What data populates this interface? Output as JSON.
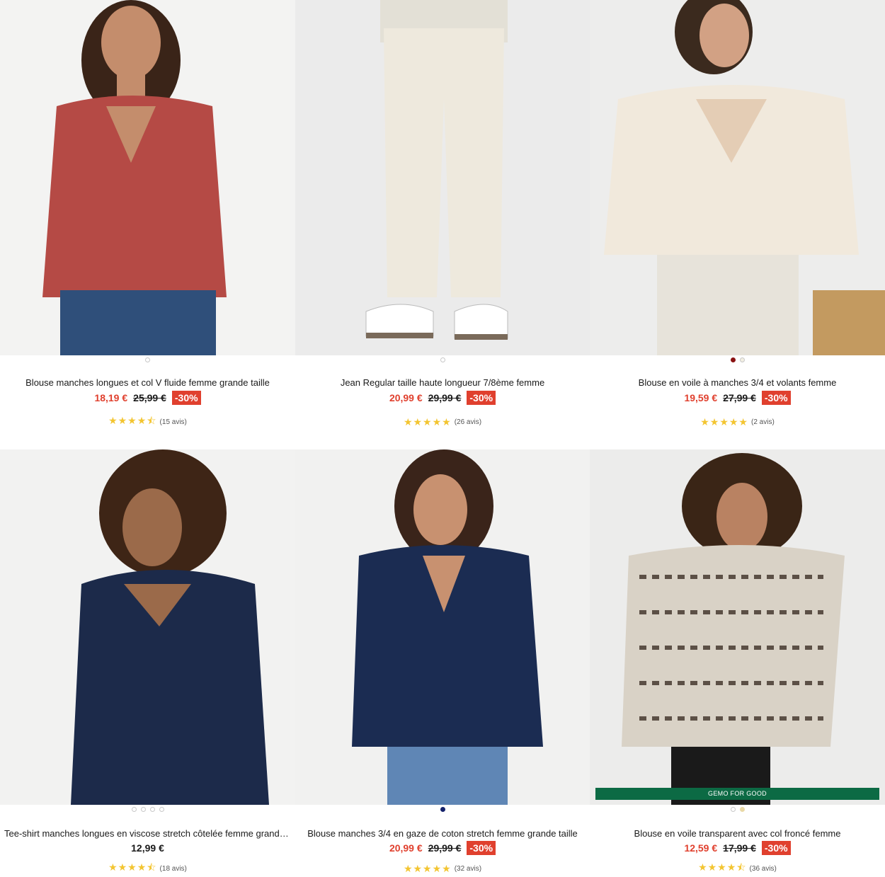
{
  "products": [
    {
      "title": "Blouse manches longues et col V fluide femme grande taille",
      "price": "18,19 €",
      "old_price": "25,99 €",
      "discount": "-30%",
      "stars": "★★★★⯪",
      "reviews": "(15 avis)",
      "colors": [
        "#ffffff"
      ]
    },
    {
      "title": "Jean Regular taille haute longueur 7/8ème femme",
      "price": "20,99 €",
      "old_price": "29,99 €",
      "discount": "-30%",
      "stars": "★★★★★",
      "reviews": "(26 avis)",
      "colors": [
        "#ffffff"
      ]
    },
    {
      "title": "Blouse en voile à manches 3/4 et volants femme",
      "price": "19,59 €",
      "old_price": "27,99 €",
      "discount": "-30%",
      "stars": "★★★★★",
      "reviews": "(2 avis)",
      "colors": [
        "#8a1212",
        "#f3efe2"
      ]
    },
    {
      "title": "Tee-shirt manches longues en viscose stretch côtelée femme grande taille",
      "price": "12,99 €",
      "stars": "★★★★⯪",
      "reviews": "(18 avis)",
      "colors": [
        "#ffffff",
        "#ffffff",
        "#ffffff",
        "#ffffff"
      ]
    },
    {
      "title": "Blouse manches 3/4 en gaze de coton stretch femme grande taille",
      "price": "20,99 €",
      "old_price": "29,99 €",
      "discount": "-30%",
      "stars": "★★★★★",
      "reviews": "(32 avis)",
      "colors": [
        "#15226b"
      ]
    },
    {
      "title": "Blouse en voile transparent avec col froncé femme",
      "price": "12,59 €",
      "old_price": "17,99 €",
      "discount": "-30%",
      "stars": "★★★★⯪",
      "reviews": "(36 avis)",
      "badge": "GEMO FOR GOOD",
      "colors": [
        "#ffffff",
        "#e9d9a6"
      ]
    }
  ],
  "accent": "#e0402e",
  "star_color": "#f3c531",
  "badge_color": "#0c6a44"
}
